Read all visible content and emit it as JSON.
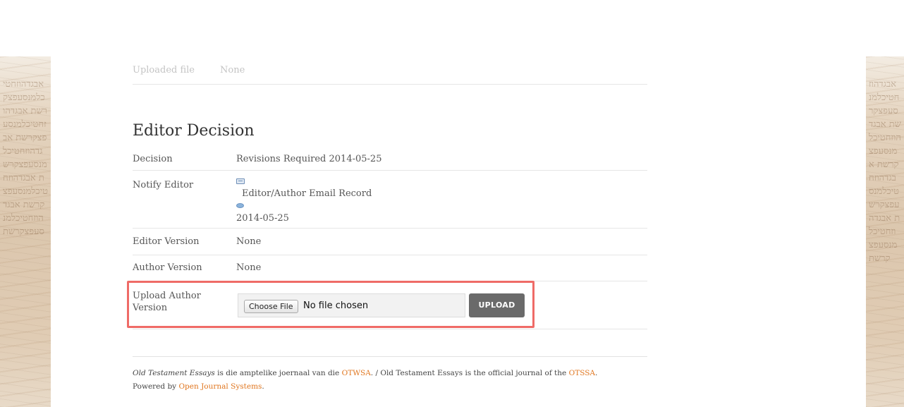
{
  "top_section": {
    "uploaded_file_label": "Uploaded file",
    "uploaded_file_value": "None"
  },
  "editor_decision": {
    "title": "Editor Decision",
    "decision_label": "Decision",
    "decision_value": "Revisions Required 2014-05-25",
    "notify_label": "Notify Editor",
    "notify_link": "Editor/Author Email Record",
    "notify_date": "2014-05-25",
    "editor_version_label": "Editor Version",
    "editor_version_value": "None",
    "author_version_label": "Author Version",
    "author_version_value": "None",
    "upload_label_line1": "Upload Author",
    "upload_label_line2": "Version",
    "choose_file_label": "Choose File",
    "no_file_text": "No file chosen",
    "upload_button": "UPLOAD"
  },
  "footer": {
    "journal_name": "Old Testament Essays",
    "text1": " is die amptelike joernaal van die ",
    "otwsa_link": "OTWSA",
    "text2": ". / Old Testament Essays is the official journal of the ",
    "otssa_link": "OTSSA",
    "text3": ".",
    "powered_text": "Powered by ",
    "ojs_link": "Open Journal Systems",
    "text4": "."
  },
  "colors": {
    "highlight": "#ef6b67",
    "link": "#e0761f",
    "upload_button": "#6a6a6a"
  }
}
